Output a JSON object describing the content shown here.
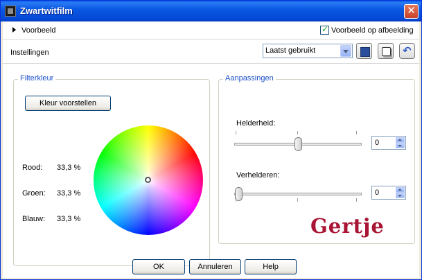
{
  "window": {
    "title": "Zwartwitfilm",
    "close_glyph": "✕"
  },
  "preview": {
    "label": "Voorbeeld",
    "checkbox_label": "Voorbeeld op afbeelding",
    "checkbox_checked": true
  },
  "settings": {
    "label": "Instellingen",
    "preset_value": "Laatst gebruikt",
    "icons": [
      "save-icon",
      "randomize-icon",
      "reset-icon"
    ]
  },
  "filter": {
    "legend": "Filterkleur",
    "suggest_button": "Kleur voorstellen",
    "channels": [
      {
        "label": "Rood:",
        "value": "33,3 %"
      },
      {
        "label": "Groen:",
        "value": "33,3 %"
      },
      {
        "label": "Blauw:",
        "value": "33,3 %"
      }
    ]
  },
  "adjustments": {
    "legend": "Aanpassingen",
    "brightness": {
      "label": "Helderheid:",
      "value": "0",
      "slider_fraction": 0.5
    },
    "clarify": {
      "label": "Verhelderen:",
      "value": "0",
      "slider_fraction": 0.0
    }
  },
  "signature": "Gertje",
  "buttons": {
    "ok": "OK",
    "cancel": "Annuleren",
    "help": "Help"
  },
  "colors": {
    "title_bar": "#0a59e4",
    "legend_text": "#1c50c8",
    "signature": "#a91535"
  }
}
